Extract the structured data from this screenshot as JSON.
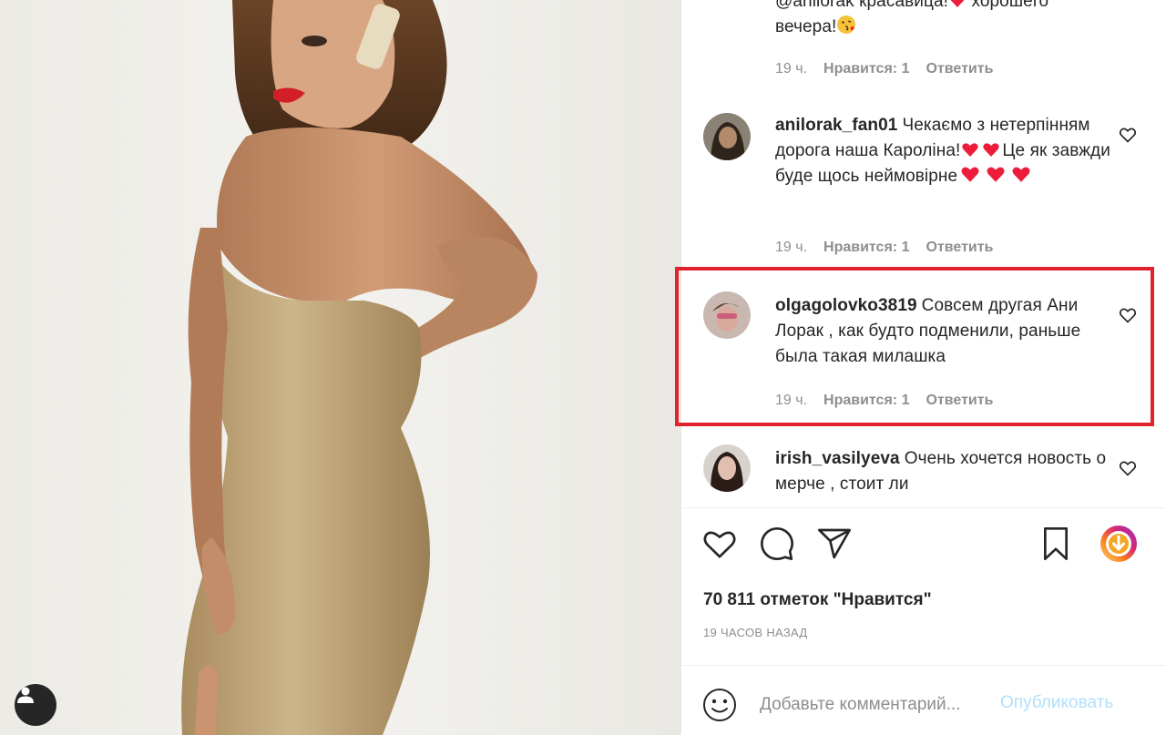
{
  "comments": [
    {
      "text_line1": "@anilorak красавица!",
      "text_line1_suffix": " хорошего",
      "text_line2": "вечера!",
      "time": "19 ч.",
      "likes": "Нравится: 1",
      "reply": "Ответить"
    },
    {
      "username": "anilorak_fan01",
      "text": "Чекаємо з нетерпінням дорога наша Кароліна!",
      "text_tail1": "Це як завжди буде щось неймовірне",
      "time": "19 ч.",
      "likes": "Нравится: 1",
      "reply": "Ответить"
    },
    {
      "username": "olgagolovko3819",
      "text": "Совсем другая Ани Лорак , как будто подменили, раньше была такая милашка",
      "time": "19 ч.",
      "likes": "Нравится: 1",
      "reply": "Ответить"
    },
    {
      "username": "irish_vasilyeva",
      "text": "Очень хочется новость о мерче , стоит ли"
    }
  ],
  "post": {
    "likes_count": "70 811 отметок \"Нравится\"",
    "time_ago": "19 ЧАСОВ НАЗАД"
  },
  "comment_box": {
    "placeholder": "Добавьте комментарий...",
    "publish_label": "Опубликовать"
  },
  "colors": {
    "highlight": "#e0222e",
    "heart": "#ed1c3a",
    "publish_disabled": "#b2dffc",
    "secondary_text": "#8e8e8e"
  },
  "icons": [
    "user-tag-icon",
    "heart-icon",
    "comment-icon",
    "share-icon",
    "bookmark-icon",
    "download-icon",
    "emoji-icon"
  ]
}
